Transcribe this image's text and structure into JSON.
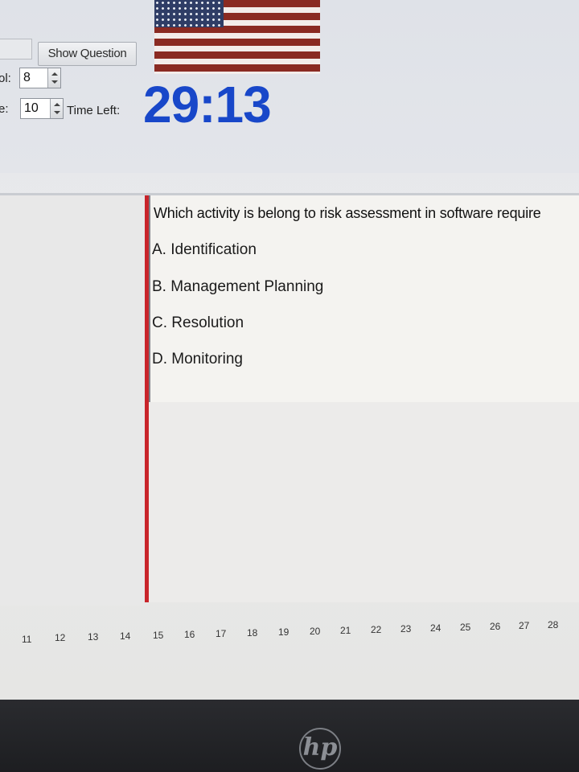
{
  "toolbar": {
    "show_question_label": "Show Question",
    "field1_label": "ol:",
    "field1_value": "8",
    "field2_label": "e:",
    "field2_value": "10",
    "time_left_label": "Time Left:",
    "timer_value": "29:13"
  },
  "question": {
    "text": "Which activity is belong to risk assessment in software require",
    "options": [
      "A. Identification",
      "B. Management Planning",
      "C. Resolution",
      "D. Monitoring"
    ]
  },
  "pagination": {
    "pages": [
      "11",
      "12",
      "13",
      "14",
      "15",
      "16",
      "17",
      "18",
      "19",
      "20",
      "21",
      "22",
      "23",
      "24",
      "25",
      "26",
      "27",
      "28"
    ]
  },
  "device": {
    "logo_text": "hp"
  }
}
